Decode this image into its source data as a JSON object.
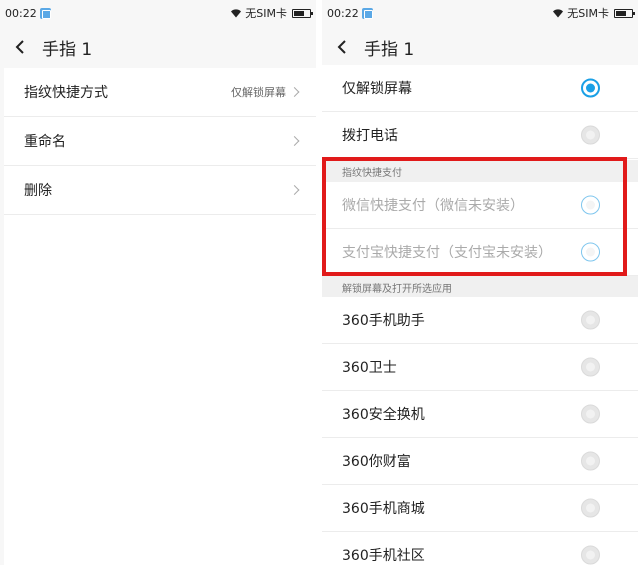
{
  "status": {
    "time": "00:22",
    "carrier": "无SIM卡"
  },
  "left": {
    "title": "手指 1",
    "rows": [
      {
        "label": "指纹快捷方式",
        "value": "仅解锁屏幕"
      },
      {
        "label": "重命名",
        "value": ""
      },
      {
        "label": "删除",
        "value": ""
      }
    ]
  },
  "right": {
    "title": "手指 1",
    "options": [
      {
        "label": "仅解锁屏幕",
        "selected": true
      },
      {
        "label": "拨打电话",
        "selected": false
      }
    ],
    "payment_header": "指纹快捷支付",
    "payment_options": [
      {
        "label": "微信快捷支付（微信未安装）",
        "disabled": true
      },
      {
        "label": "支付宝快捷支付（支付宝未安装）",
        "disabled": true
      }
    ],
    "apps_header": "解锁屏幕及打开所选应用",
    "apps": [
      {
        "label": "360手机助手"
      },
      {
        "label": "360卫士"
      },
      {
        "label": "360安全换机"
      },
      {
        "label": "360你财富"
      },
      {
        "label": "360手机商城"
      },
      {
        "label": "360手机社区"
      }
    ]
  },
  "colors": {
    "accent": "#1aa0e6",
    "highlight": "#e11a1a"
  },
  "icons": [
    "sync-icon",
    "wifi-icon",
    "battery-icon",
    "back-icon",
    "chevron-right-icon",
    "radio-icon"
  ]
}
